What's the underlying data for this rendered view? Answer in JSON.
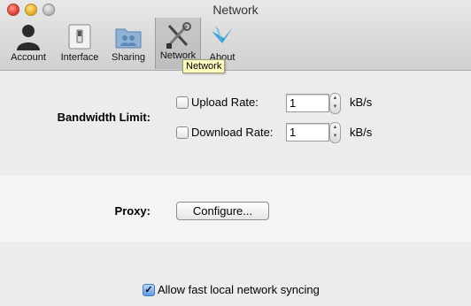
{
  "window": {
    "title": "Network"
  },
  "toolbar": {
    "tabs": [
      {
        "label": "Account",
        "icon": "account-icon"
      },
      {
        "label": "Interface",
        "icon": "interface-icon"
      },
      {
        "label": "Sharing",
        "icon": "sharing-icon"
      },
      {
        "label": "Network",
        "icon": "network-tools-icon",
        "selected": true
      },
      {
        "label": "About",
        "icon": "about-icon"
      }
    ],
    "tooltip": "Network"
  },
  "bandwidth": {
    "label": "Bandwidth Limit:",
    "upload": {
      "label": "Upload Rate:",
      "value": "1",
      "unit": "kB/s",
      "checked": false
    },
    "download": {
      "label": "Download Rate:",
      "value": "1",
      "unit": "kB/s",
      "checked": false
    }
  },
  "proxy": {
    "label": "Proxy:",
    "button": "Configure..."
  },
  "sync": {
    "label": "Allow fast local network syncing",
    "checked": true
  },
  "colors": {
    "accent": "#5d9de6",
    "tooltip_bg": "#fdfbbf"
  }
}
